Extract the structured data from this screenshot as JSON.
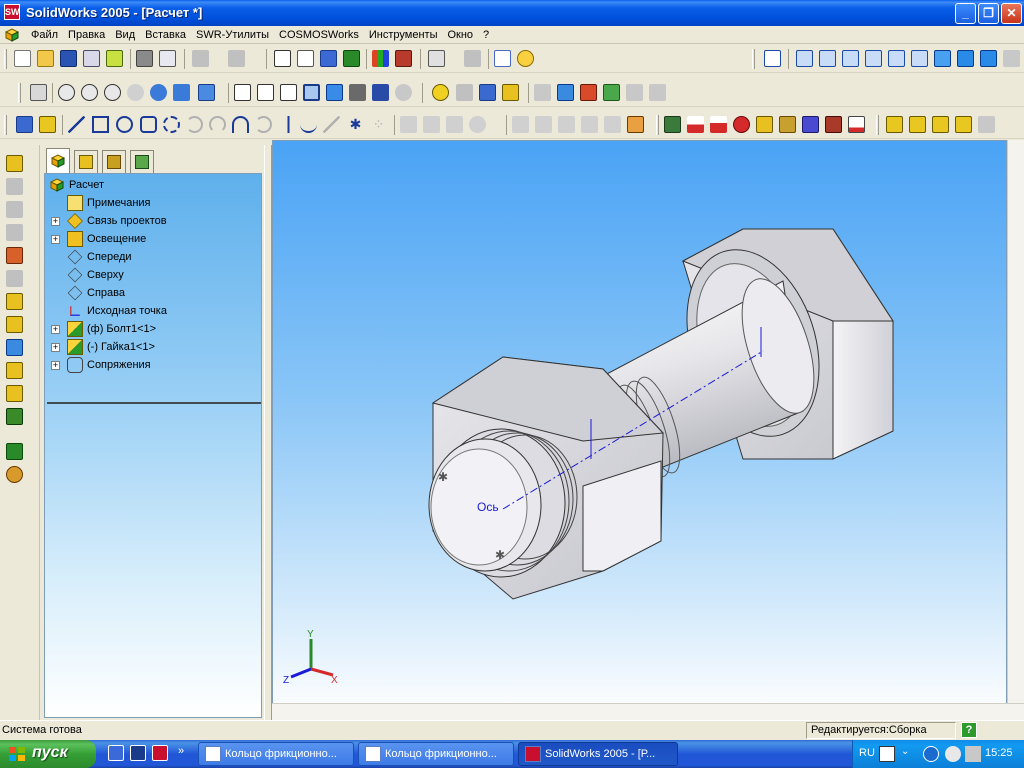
{
  "window": {
    "title": "SolidWorks 2005 - [Расчет *]",
    "app_icon_text": "SW",
    "minimize": "_",
    "maximize": "❐",
    "close": "✕"
  },
  "menu": {
    "items": [
      "Файл",
      "Правка",
      "Вид",
      "Вставка",
      "SWR-Утилиты",
      "COSMOSWorks",
      "Инструменты",
      "Окно",
      "?"
    ],
    "mdi_min": "_",
    "mdi_restore": "❐",
    "mdi_close": "×"
  },
  "feature_tree": {
    "root": "Расчет",
    "items": [
      {
        "label": "Примечания",
        "expandable": false,
        "icon": "annotations-icon"
      },
      {
        "label": "Связь проектов",
        "expandable": true,
        "icon": "design-binder-icon"
      },
      {
        "label": "Освещение",
        "expandable": true,
        "icon": "lighting-icon"
      },
      {
        "label": "Спереди",
        "expandable": false,
        "icon": "plane-icon"
      },
      {
        "label": "Сверху",
        "expandable": false,
        "icon": "plane-icon"
      },
      {
        "label": "Справа",
        "expandable": false,
        "icon": "plane-icon"
      },
      {
        "label": "Исходная точка",
        "expandable": false,
        "icon": "origin-icon"
      },
      {
        "label": "(ф) Болт1<1>",
        "expandable": true,
        "icon": "part-icon"
      },
      {
        "label": "(-) Гайка1<1>",
        "expandable": true,
        "icon": "part-icon"
      },
      {
        "label": "Сопряжения",
        "expandable": true,
        "icon": "mates-icon"
      }
    ]
  },
  "graphics": {
    "axis_label": "Ось",
    "triad": {
      "x": "X",
      "y": "Y",
      "z": "Z"
    }
  },
  "status": {
    "left": "Система готова",
    "right": "Редактируется:Сборка",
    "help": "?"
  },
  "taskbar": {
    "start": "пуск",
    "tasks": [
      {
        "label": "Кольцо фрикционно...",
        "active": false
      },
      {
        "label": "Кольцо фрикционно...",
        "active": false
      },
      {
        "label": "SolidWorks 2005 - [Р...",
        "active": true
      }
    ],
    "lang": "RU",
    "clock": "15:25"
  },
  "colors": {
    "title_blue": "#0a5ee8",
    "gfx_top": "#4aa3f5",
    "taskbar_blue": "#2157d7",
    "start_green": "#35a035"
  }
}
